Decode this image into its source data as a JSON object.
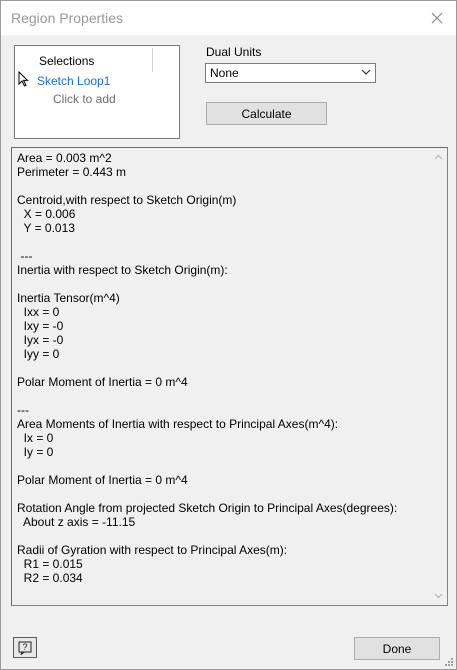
{
  "window": {
    "title": "Region Properties"
  },
  "selections": {
    "header": "Selections",
    "item": "Sketch Loop1",
    "add_hint": "Click to add"
  },
  "dual_units": {
    "label": "Dual Units",
    "selected": "None"
  },
  "buttons": {
    "calculate": "Calculate",
    "done": "Done"
  },
  "results": {
    "text": "Area = 0.003 m^2\nPerimeter = 0.443 m\n\nCentroid,with respect to Sketch Origin(m)\n  X = 0.006\n  Y = 0.013\n\n ---\nInertia with respect to Sketch Origin(m):\n\nInertia Tensor(m^4)\n  Ixx = 0\n  Ixy = -0\n  Iyx = -0\n  Iyy = 0\n\nPolar Moment of Inertia = 0 m^4\n\n---\nArea Moments of Inertia with respect to Principal Axes(m^4):\n  Ix = 0\n  Iy = 0\n\nPolar Moment of Inertia = 0 m^4\n\nRotation Angle from projected Sketch Origin to Principal Axes(degrees):\n  About z axis = -11.15\n\nRadii of Gyration with respect to Principal Axes(m):\n  R1 = 0.015\n  R2 = 0.034"
  },
  "icons": {
    "close": "close-icon",
    "help": "help-icon",
    "dropdown": "chevron-down-icon",
    "scroll_up": "scroll-up-icon",
    "scroll_down": "scroll-down-icon",
    "cursor": "mouse-pointer-icon",
    "resize": "resize-grip-icon"
  },
  "colors": {
    "link": "#1a6fc9",
    "hint": "#6d6d6d",
    "title": "#999999"
  }
}
